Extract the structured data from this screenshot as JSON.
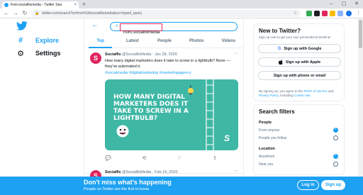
{
  "browser": {
    "tab_title": "from:socialfixmedia - Twitter Sea",
    "tab_close": "×",
    "new_tab": "+",
    "url": "twitter.com/search?q=from%3Asocialfixmedia&src=typed_query",
    "window_controls": [
      "–",
      "▢",
      "✕"
    ]
  },
  "sidebar": {
    "items": [
      {
        "label": "Explore",
        "icon": "hashtag-icon",
        "glyph": "#"
      },
      {
        "label": "Settings",
        "icon": "gear-icon",
        "glyph": "⚙"
      }
    ]
  },
  "search": {
    "value": "from:socialfixmedia",
    "back_glyph": "←",
    "search_glyph": "🔍"
  },
  "tabs": [
    "Top",
    "Latest",
    "People",
    "Photos",
    "Videos"
  ],
  "tweets": [
    {
      "avatar_letter": "S",
      "name": "Socialfix",
      "meta": "@SocialfixMedia · Jan 28, 2020",
      "text": "How many digital marketers does it take to screw in a lightbulb? None — they've automated it.",
      "hashtags": "#socialmedia #digitalmarketing #marketingagency",
      "image_headline": "How many digital marketers does it take to screw in a lightbulb?",
      "image_logo": "S",
      "actions": [
        "💬",
        "⟲",
        "♡",
        "⇪"
      ]
    },
    {
      "avatar_letter": "S",
      "name": "Socialfix",
      "meta": "@SocialfixMedia · Feb 19, 2020"
    }
  ],
  "signup_panel": {
    "title": "New to Twitter?",
    "subtitle": "Sign up now to get your own personalized timeline!",
    "buttons": [
      {
        "label": "Sign up with Google",
        "icon": "google-icon",
        "glyph": "G"
      },
      {
        "label": "Sign up with Apple",
        "icon": "apple-icon",
        "glyph": ""
      },
      {
        "label": "Sign up with phone or email",
        "icon": "",
        "glyph": ""
      }
    ],
    "terms_prefix": "By signing up, you agree to the ",
    "terms_link": "Terms of Service",
    "terms_mid": " and ",
    "privacy_link": "Privacy Policy",
    "terms_mid2": ", including ",
    "cookie_link": "Cookie Use",
    "terms_end": "."
  },
  "filters": {
    "title": "Search filters",
    "sections": [
      {
        "heading": "People",
        "options": [
          {
            "label": "From anyone",
            "selected": true
          },
          {
            "label": "People you follow",
            "selected": false
          }
        ]
      },
      {
        "heading": "Location",
        "options": [
          {
            "label": "Anywhere",
            "selected": true
          },
          {
            "label": "Near you",
            "selected": false
          }
        ]
      }
    ]
  },
  "banner": {
    "heading": "Don't miss what's happening",
    "subtext": "People on Twitter are the first to know.",
    "login": "Log in",
    "signup": "Sign up"
  },
  "colors": {
    "brand": "#1da1f2",
    "highlight": "#e0245e",
    "image_bg": "#3fb7a5"
  }
}
